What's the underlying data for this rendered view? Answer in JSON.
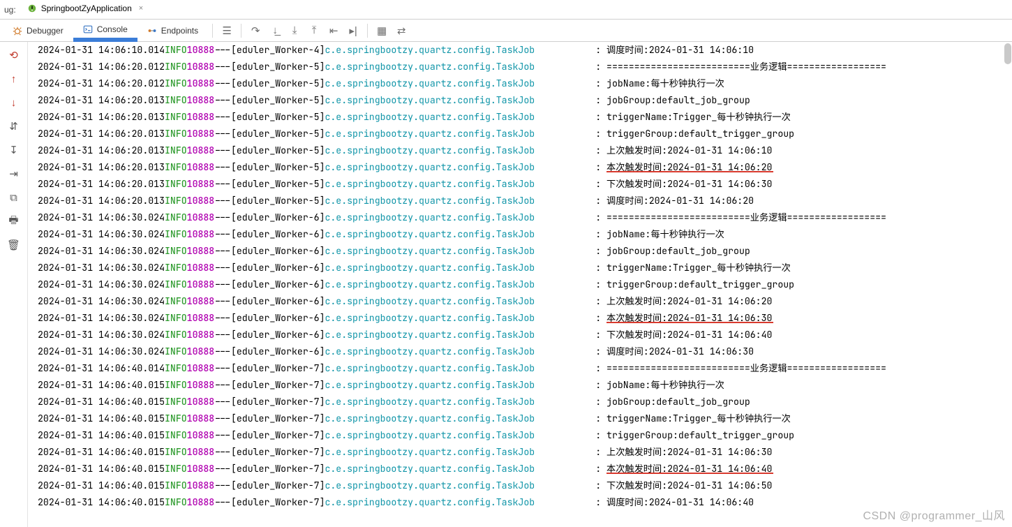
{
  "top": {
    "run_prefix": "ug:",
    "tab_name": "SpringbootZyApplication",
    "close_glyph": "×"
  },
  "tabs": {
    "debugger": "Debugger",
    "console": "Console",
    "endpoints": "Endpoints"
  },
  "watermark": "CSDN @programmer_山风",
  "pid": "10888",
  "level": "INFO",
  "dashes": "---",
  "logger": "c.e.springbootzy.quartz.config.TaskJob",
  "colon": ":",
  "log": [
    {
      "ts": "2024-01-31 14:06:10.014",
      "thr": "[eduler_Worker-4]",
      "msg": "调度时间:2024-01-31 14:06:10",
      "cut": true
    },
    {
      "ts": "2024-01-31 14:06:20.012",
      "thr": "[eduler_Worker-5]",
      "msg": "==========================业务逻辑=================="
    },
    {
      "ts": "2024-01-31 14:06:20.012",
      "thr": "[eduler_Worker-5]",
      "msg": "jobName:每十秒钟执行一次"
    },
    {
      "ts": "2024-01-31 14:06:20.013",
      "thr": "[eduler_Worker-5]",
      "msg": "jobGroup:default_job_group"
    },
    {
      "ts": "2024-01-31 14:06:20.013",
      "thr": "[eduler_Worker-5]",
      "msg": "triggerName:Trigger_每十秒钟执行一次"
    },
    {
      "ts": "2024-01-31 14:06:20.013",
      "thr": "[eduler_Worker-5]",
      "msg": "triggerGroup:default_trigger_group"
    },
    {
      "ts": "2024-01-31 14:06:20.013",
      "thr": "[eduler_Worker-5]",
      "msg": "上次触发时间:2024-01-31 14:06:10"
    },
    {
      "ts": "2024-01-31 14:06:20.013",
      "thr": "[eduler_Worker-5]",
      "msg": "本次触发时间:2024-01-31 14:06:20",
      "hl": true
    },
    {
      "ts": "2024-01-31 14:06:20.013",
      "thr": "[eduler_Worker-5]",
      "msg": "下次触发时间:2024-01-31 14:06:30"
    },
    {
      "ts": "2024-01-31 14:06:20.013",
      "thr": "[eduler_Worker-5]",
      "msg": "调度时间:2024-01-31 14:06:20"
    },
    {
      "ts": "2024-01-31 14:06:30.024",
      "thr": "[eduler_Worker-6]",
      "msg": "==========================业务逻辑=================="
    },
    {
      "ts": "2024-01-31 14:06:30.024",
      "thr": "[eduler_Worker-6]",
      "msg": "jobName:每十秒钟执行一次"
    },
    {
      "ts": "2024-01-31 14:06:30.024",
      "thr": "[eduler_Worker-6]",
      "msg": "jobGroup:default_job_group"
    },
    {
      "ts": "2024-01-31 14:06:30.024",
      "thr": "[eduler_Worker-6]",
      "msg": "triggerName:Trigger_每十秒钟执行一次"
    },
    {
      "ts": "2024-01-31 14:06:30.024",
      "thr": "[eduler_Worker-6]",
      "msg": "triggerGroup:default_trigger_group"
    },
    {
      "ts": "2024-01-31 14:06:30.024",
      "thr": "[eduler_Worker-6]",
      "msg": "上次触发时间:2024-01-31 14:06:20"
    },
    {
      "ts": "2024-01-31 14:06:30.024",
      "thr": "[eduler_Worker-6]",
      "msg": "本次触发时间:2024-01-31 14:06:30",
      "hl": true
    },
    {
      "ts": "2024-01-31 14:06:30.024",
      "thr": "[eduler_Worker-6]",
      "msg": "下次触发时间:2024-01-31 14:06:40"
    },
    {
      "ts": "2024-01-31 14:06:30.024",
      "thr": "[eduler_Worker-6]",
      "msg": "调度时间:2024-01-31 14:06:30"
    },
    {
      "ts": "2024-01-31 14:06:40.014",
      "thr": "[eduler_Worker-7]",
      "msg": "==========================业务逻辑=================="
    },
    {
      "ts": "2024-01-31 14:06:40.015",
      "thr": "[eduler_Worker-7]",
      "msg": "jobName:每十秒钟执行一次"
    },
    {
      "ts": "2024-01-31 14:06:40.015",
      "thr": "[eduler_Worker-7]",
      "msg": "jobGroup:default_job_group"
    },
    {
      "ts": "2024-01-31 14:06:40.015",
      "thr": "[eduler_Worker-7]",
      "msg": "triggerName:Trigger_每十秒钟执行一次"
    },
    {
      "ts": "2024-01-31 14:06:40.015",
      "thr": "[eduler_Worker-7]",
      "msg": "triggerGroup:default_trigger_group"
    },
    {
      "ts": "2024-01-31 14:06:40.015",
      "thr": "[eduler_Worker-7]",
      "msg": "上次触发时间:2024-01-31 14:06:30"
    },
    {
      "ts": "2024-01-31 14:06:40.015",
      "thr": "[eduler_Worker-7]",
      "msg": "本次触发时间:2024-01-31 14:06:40",
      "hl": true
    },
    {
      "ts": "2024-01-31 14:06:40.015",
      "thr": "[eduler_Worker-7]",
      "msg": "下次触发时间:2024-01-31 14:06:50"
    },
    {
      "ts": "2024-01-31 14:06:40.015",
      "thr": "[eduler_Worker-7]",
      "msg": "调度时间:2024-01-31 14:06:40"
    }
  ]
}
